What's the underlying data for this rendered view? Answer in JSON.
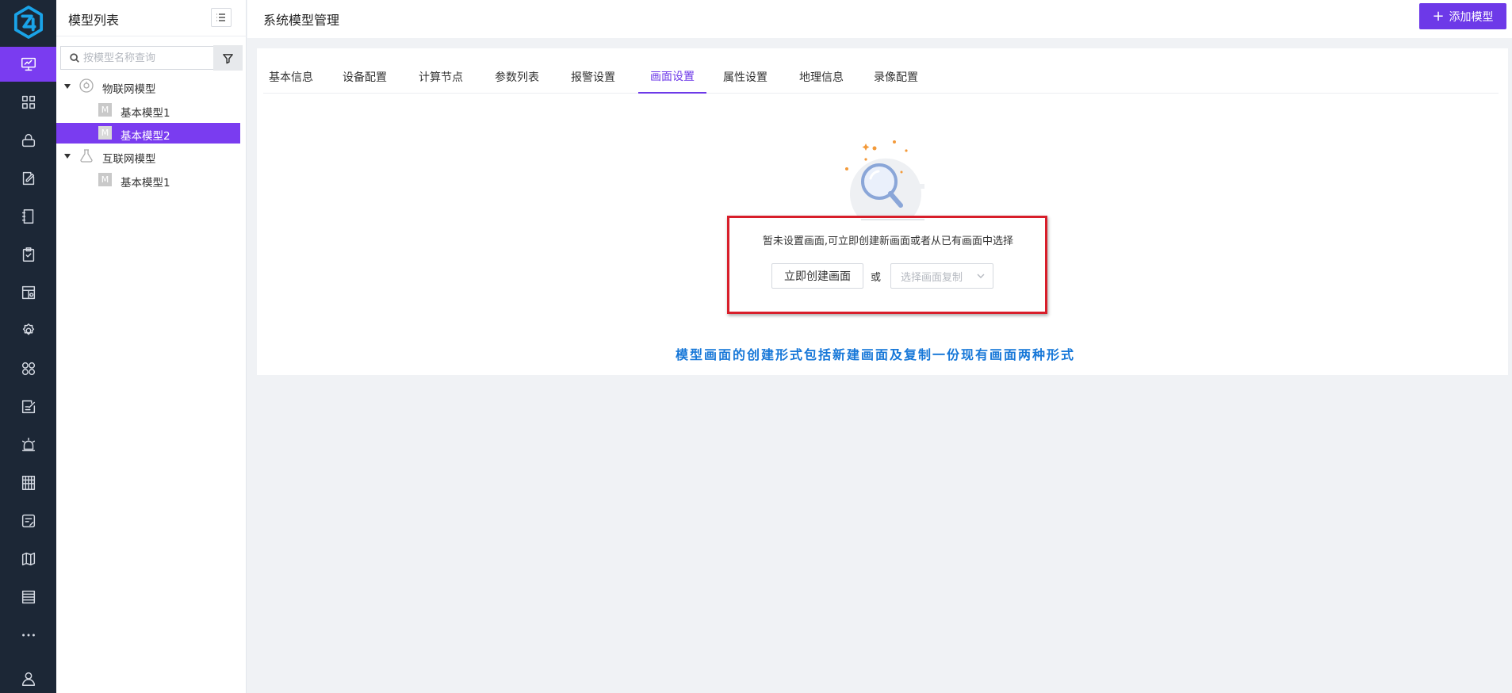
{
  "app": {
    "page_title": "系统模型管理",
    "add_button_label": "添加模型"
  },
  "rail": {
    "items": [
      {
        "icon": "monitor-icon",
        "active": true
      },
      {
        "icon": "grid-icon"
      },
      {
        "icon": "lock-icon"
      },
      {
        "icon": "edit-note-icon"
      },
      {
        "icon": "notebook-icon"
      },
      {
        "icon": "clipboard-check-icon"
      },
      {
        "icon": "image-gallery-icon"
      },
      {
        "icon": "settings-icon"
      },
      {
        "icon": "apps-icon"
      },
      {
        "icon": "form-edit-icon"
      },
      {
        "icon": "alarm-light-icon"
      },
      {
        "icon": "building-icon"
      },
      {
        "icon": "card-edit-icon"
      },
      {
        "icon": "map-icon"
      },
      {
        "icon": "list-icon"
      },
      {
        "icon": "more-icon"
      },
      {
        "icon": "user-icon"
      }
    ]
  },
  "tree": {
    "title": "模型列表",
    "search_placeholder": "按模型名称查询",
    "nodes": [
      {
        "label": "物联网模型",
        "type": "group",
        "expanded": true
      },
      {
        "label": "基本模型1",
        "badge": "M",
        "type": "leaf"
      },
      {
        "label": "基本模型2",
        "badge": "M",
        "type": "leaf",
        "selected": true
      },
      {
        "label": "互联网模型",
        "type": "group",
        "expanded": true
      },
      {
        "label": "基本模型1",
        "badge": "M",
        "type": "leaf"
      }
    ]
  },
  "tabs": [
    {
      "label": "基本信息"
    },
    {
      "label": "设备配置"
    },
    {
      "label": "计算节点"
    },
    {
      "label": "参数列表"
    },
    {
      "label": "报警设置"
    },
    {
      "label": "画面设置",
      "active": true
    },
    {
      "label": "属性设置"
    },
    {
      "label": "地理信息"
    },
    {
      "label": "录像配置"
    }
  ],
  "empty_state": {
    "message": "暂未设置画面,可立即创建新画面或者从已有画面中选择",
    "create_button": "立即创建画面",
    "or_text": "或",
    "copy_select_placeholder": "选择画面复制"
  },
  "annotation": "模型画面的创建形式包括新建画面及复制一份现有画面两种形式",
  "colors": {
    "accent": "#6d39e8",
    "rail_bg": "#1c2736",
    "highlight_frame": "#d81e2a",
    "annotation": "#1677d8"
  }
}
